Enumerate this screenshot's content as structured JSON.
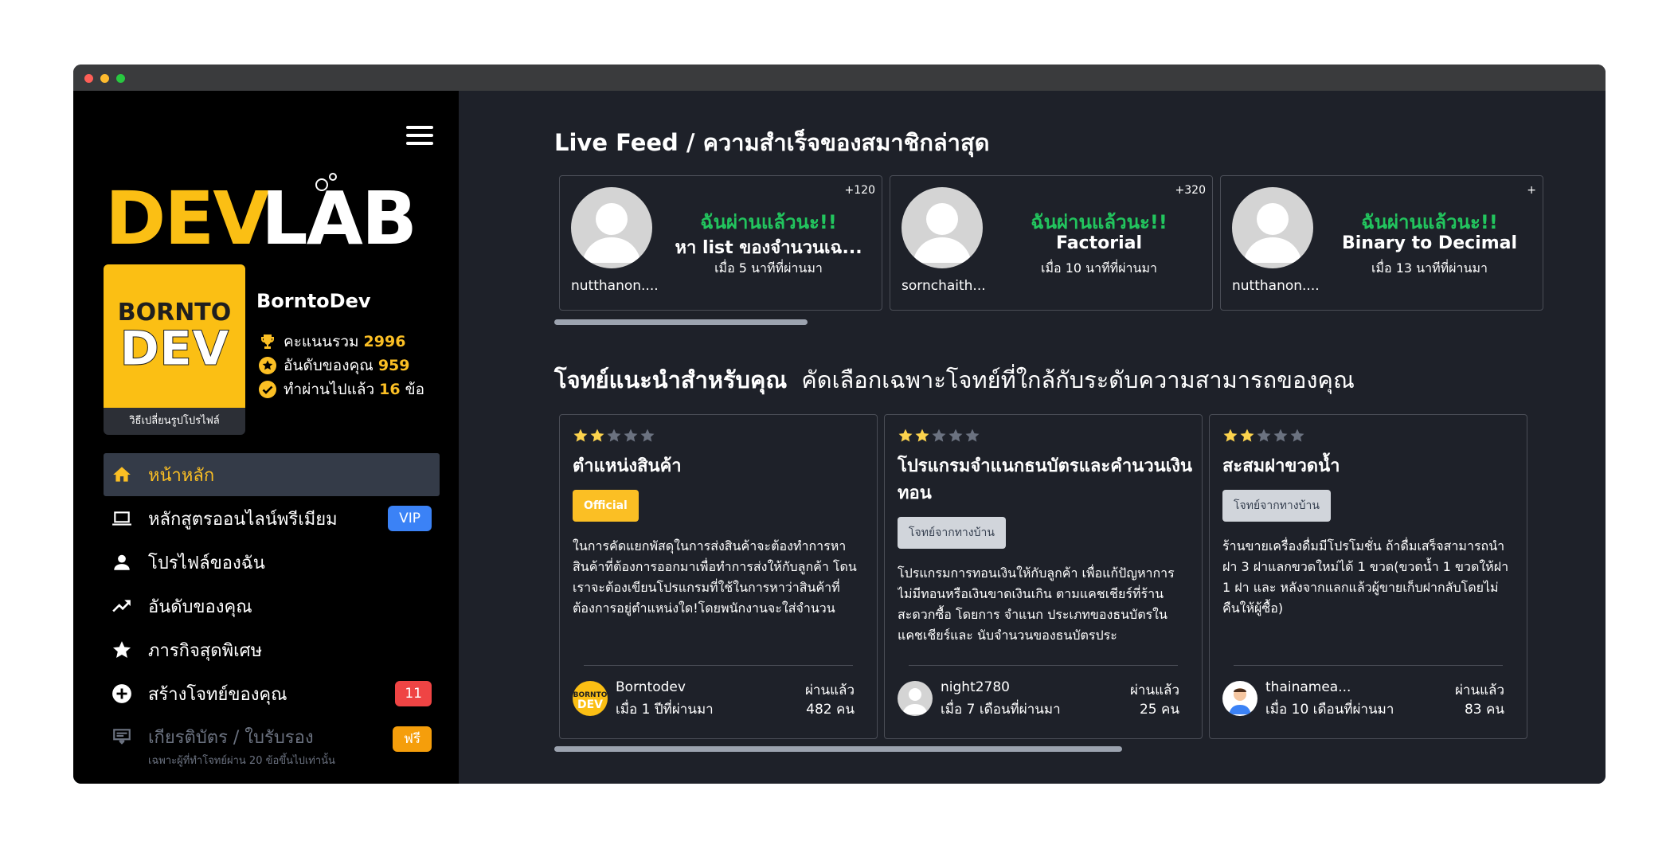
{
  "sidebar": {
    "logo_text": "DEVLAB",
    "avatar_logo": [
      "BORNTO",
      "DEV"
    ],
    "change_avatar": "วิธีเปลี่ยนรูปโปรไฟล์",
    "username": "BorntoDev",
    "stats": [
      {
        "label": "คะแนนรวม",
        "value": "2996",
        "icon": "trophy-icon"
      },
      {
        "label": "อันดับของคุณ",
        "value": "959",
        "icon": "star-circle-icon"
      },
      {
        "label": "ทำผ่านไปแล้ว",
        "value": "16",
        "suffix": "ข้อ",
        "icon": "check-circle-icon"
      }
    ],
    "nav": [
      {
        "label": "หน้าหลัก",
        "icon": "home-icon",
        "active": true
      },
      {
        "label": "หลักสูตรออนไลน์พรีเมียม",
        "icon": "laptop-icon",
        "badge": "VIP"
      },
      {
        "label": "โปรไฟล์ของฉัน",
        "icon": "person-icon"
      },
      {
        "label": "อันดับของคุณ",
        "icon": "trending-up-icon"
      },
      {
        "label": "ภารกิจสุดพิเศษ",
        "icon": "star-icon"
      },
      {
        "label": "สร้างโจทย์ของคุณ",
        "icon": "add-circle-icon",
        "badge": "11"
      },
      {
        "label": "เกียรติบัตร / ใบรับรอง",
        "icon": "certificate-icon",
        "badge": "ฟรี",
        "sub": "เฉพาะผู้ที่ทำโจทย์ผ่าน 20 ข้อขึ้นไปเท่านั้น"
      }
    ]
  },
  "feed": {
    "title": "Live Feed / ความสำเร็จของสมาชิกล่าสุด",
    "items": [
      {
        "points": "+120",
        "status": "ฉันผ่านแล้วนะ!!",
        "problem": "หา list ของจำนวนเฉ...",
        "time": "เมื่อ 5 นาทีที่ผ่านมา",
        "user": "nutthanon...."
      },
      {
        "points": "+320",
        "status": "ฉันผ่านแล้วนะ!!",
        "problem": "Factorial",
        "time": "เมื่อ 10 นาทีที่ผ่านมา",
        "user": "sornchaith..."
      },
      {
        "points": "+",
        "status": "ฉันผ่านแล้วนะ!!",
        "problem": "Binary to Decimal",
        "time": "เมื่อ 13 นาทีที่ผ่านมา",
        "user": "nutthanon...."
      }
    ]
  },
  "challenges": {
    "title": "โจทย์แนะนำสำหรับคุณ",
    "subtitle": "คัดเลือกเฉพาะโจทย์ที่ใกล้กับระดับความสามารถของคุณ",
    "items": [
      {
        "stars": 2,
        "title": "ตำแหน่งสินค้า",
        "tag": "Official",
        "tag_type": "official",
        "desc": "ในการคัดแยกพัสดุในการส่งสินค้าจะต้องทำการหาสินค้าที่ต้องการออกมาเพื่อทำการส่งให้กับลูกค้า โดนเราจะต้องเขียนโปรแกรมที่ใช้ในการหาว่าสินค้าที่ต้องการอยู่ตำแหน่งใด!โดยพนักงานจะใส่จำนวน",
        "author": "Borntodev",
        "date": "เมื่อ 1 ปีที่ผ่านมา",
        "pass_label": "ผ่านแล้ว",
        "count": "482 คน"
      },
      {
        "stars": 2,
        "title": "โปรแกรมจำแนกธนบัตรและคำนวนเงินทอน",
        "tag": "โจทย์จากทางบ้าน",
        "tag_type": "home",
        "desc": "โปรแกรมการทอนเงินให้กับลูกค้า เพื่อแก้ปัญหาการไม่มีทอนหรือเงินขาดเงินเกิน ตามแคชเชียร์ที่ร้านสะดวกซื้อ โดยการ จำแนก ประเภทของธนบัตรในแคชเชียร์และ นับจำนวนของธนบัตรประ",
        "author": "night2780",
        "date": "เมื่อ 7 เดือนที่ผ่านมา",
        "pass_label": "ผ่านแล้ว",
        "count": "25 คน"
      },
      {
        "stars": 2,
        "title": "สะสมฝาขวดน้ำ",
        "tag": "โจทย์จากทางบ้าน",
        "tag_type": "home",
        "desc": "ร้านขายเครื่องดื่มมีโปรโมชั่น ถ้าดื่มเสร็จสามารถนำฝา 3 ฝาแลกขวดใหม่ได้ 1 ขวด(ขวดน้ำ 1 ขวดให้ฝา 1 ฝา และ หลังจากแลกแล้วผู้ขายเก็บฝากลับโดยไม่คืนให้ผู้ซื้อ)",
        "author": "thainamea...",
        "date": "เมื่อ 10 เดือนที่ผ่านมา",
        "pass_label": "ผ่านแล้ว",
        "count": "83 คน"
      }
    ]
  },
  "colors": {
    "accent": "#fbbf24",
    "success": "#22c55e",
    "vip": "#3b82f6",
    "sidebar_bg": "#000000",
    "main_bg": "#1e2129"
  }
}
